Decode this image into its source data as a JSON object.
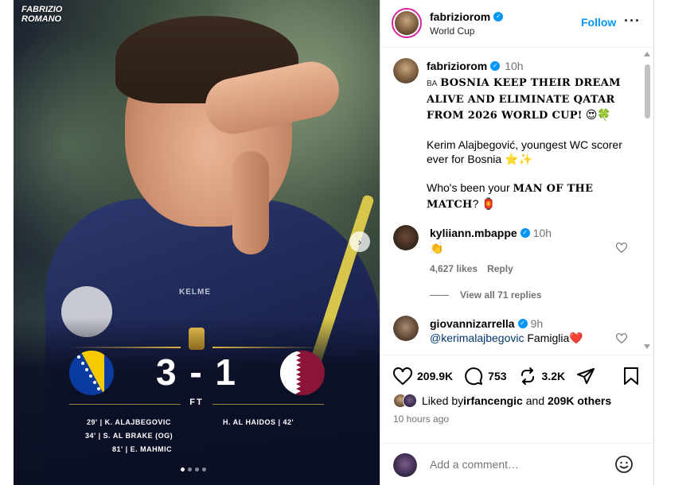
{
  "media": {
    "watermark": "FABRIZIO\nROMANO",
    "watermark_line1": "FABRIZIO",
    "watermark_line2": "ROMANO",
    "score": "3 - 1",
    "status": "FT",
    "home_scorers": [
      "29' | K. ALAJBEGOVIC",
      "34' | S. AL BRAKE (OG)",
      "81' | E. MAHMIC"
    ],
    "away_scorers": [
      "H. AL HAIDOS | 42'"
    ],
    "shirt_brand": "KELME",
    "carousel_total": 4,
    "carousel_active": 1
  },
  "header": {
    "username": "fabriziorom",
    "subtitle": "World Cup",
    "follow_label": "Follow",
    "more_label": "···"
  },
  "caption": {
    "username": "fabriziorom",
    "time": "10h",
    "flag_code": "BA",
    "headline": "BOSNIA KEEP THEIR DREAM ALIVE AND ELIMINATE QATAR FROM 2026 WORLD CUP!",
    "headline_emoji": "😍🍀",
    "para2": "Kerim Alajbegović, youngest WC scorer ever for Bosnia",
    "para2_emoji": "⭐✨",
    "para3_prefix": "Who's been your ",
    "para3_bold": "MAN OF THE MATCH",
    "para3_suffix": "?",
    "para3_emoji": "🏮"
  },
  "comments": [
    {
      "username": "kyliiann.mbappe",
      "time": "10h",
      "text": "👏",
      "likes": "4,627 likes",
      "reply_label": "Reply",
      "view_replies": "View all 71 replies"
    },
    {
      "username": "giovannizarrella",
      "time": "9h",
      "mention": "@kerimalajbegovic",
      "text": " Famiglia❤️"
    }
  ],
  "actions": {
    "likes": "209.9K",
    "comments": "753",
    "reposts": "3.2K",
    "liked_by_prefix": "Liked by ",
    "liked_by_user": "irfancengic",
    "liked_by_and": " and ",
    "liked_by_others": "209K others",
    "posted_time": "10 hours ago"
  },
  "add_comment": {
    "placeholder": "Add a comment…"
  },
  "colors": {
    "accent": "#0095f6",
    "bosnia_blue": "#0a3ba0",
    "bosnia_yellow": "#f7c900",
    "qatar_maroon": "#8a1538",
    "gold": "#d8b34a"
  }
}
